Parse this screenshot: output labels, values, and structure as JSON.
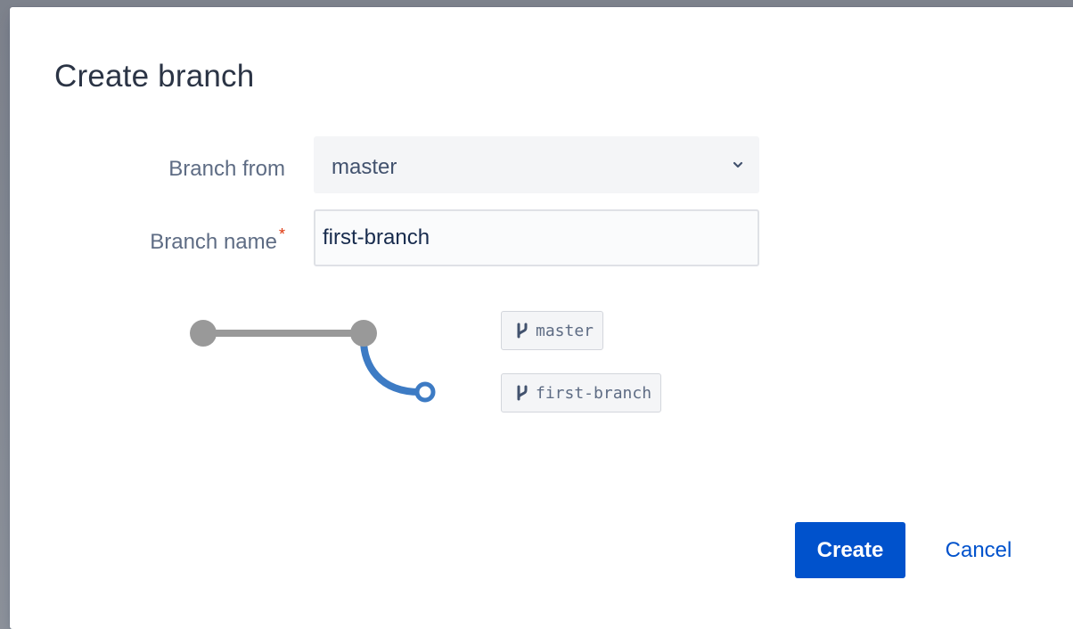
{
  "dialog": {
    "title": "Create branch"
  },
  "form": {
    "branch_from_label": "Branch from",
    "branch_from_value": "master",
    "branch_name_label": "Branch name",
    "required_mark": "*",
    "branch_name_value": "first-branch"
  },
  "diagram": {
    "source_branch": "master",
    "new_branch": "first-branch",
    "colors": {
      "trunk": "#999999",
      "branch": "#3d7bc4"
    }
  },
  "actions": {
    "create_label": "Create",
    "cancel_label": "Cancel"
  },
  "icons": {
    "select_chevron": "chevron-down-icon",
    "branch": "branch-icon"
  }
}
